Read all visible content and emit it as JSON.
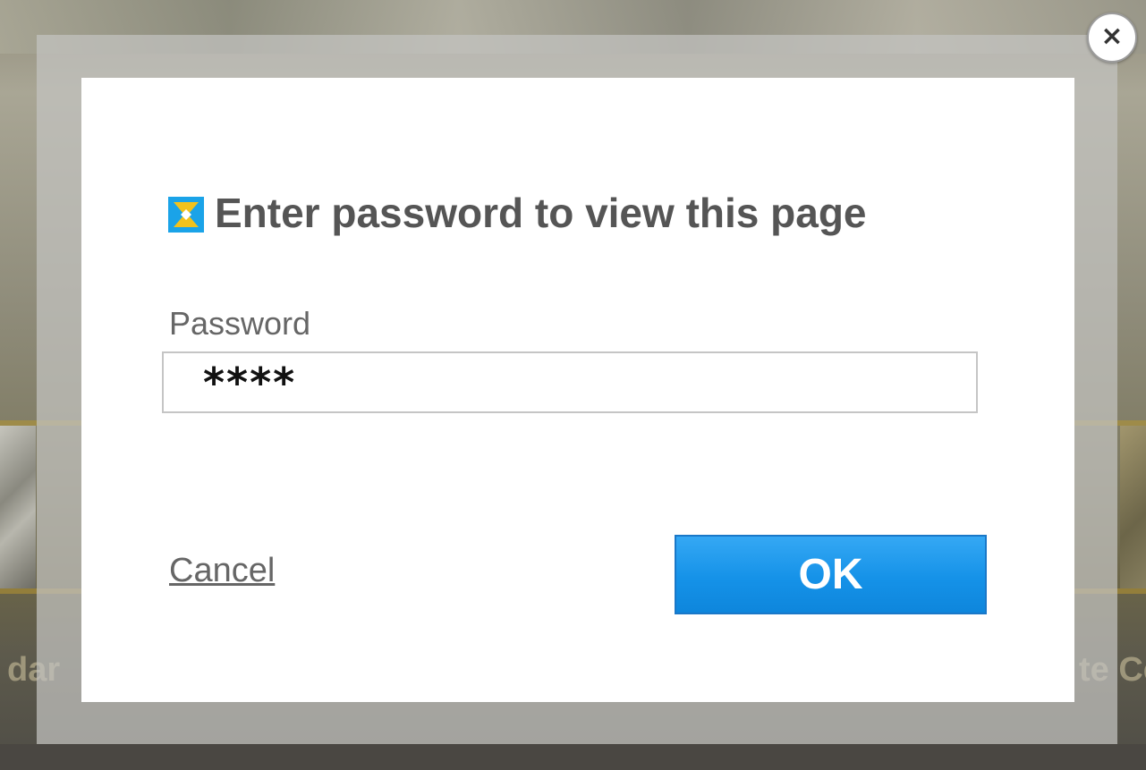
{
  "dialog": {
    "title": "Enter password to view this page",
    "title_icon": "app-logo-icon",
    "password_label": "Password",
    "password_value": "****",
    "cancel_label": "Cancel",
    "ok_label": "OK",
    "close_icon": "close-icon",
    "close_glyph": "×"
  },
  "background": {
    "left_text": "dar",
    "right_text": "te Ce"
  },
  "colors": {
    "ok_button": "#1592e8",
    "title_text": "#555555",
    "icon_blue": "#1aa3e8",
    "icon_yellow": "#f2c21b"
  }
}
